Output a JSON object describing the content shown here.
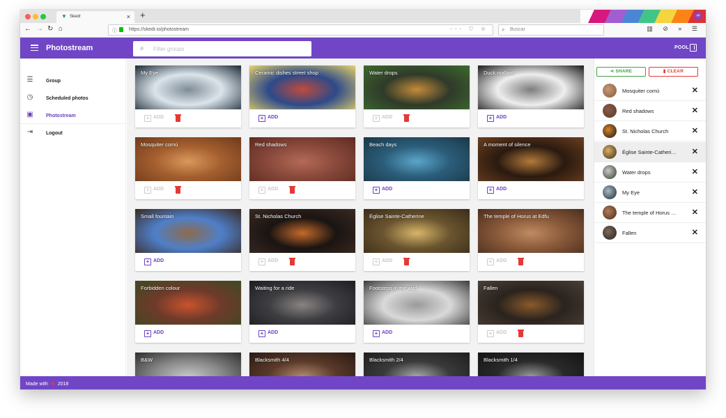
{
  "browser": {
    "tab_title": "Skedr",
    "tab_close": "×",
    "new_tab": "+",
    "url": "https://skedr.io/photostream",
    "url_actions": "··· ♡ ☆",
    "search_placeholder": "Buscar",
    "tools": "▥ ⊘ » ☰",
    "nav_back": "←",
    "nav_forward": "→",
    "nav_reload": "↻",
    "nav_home": "⌂"
  },
  "app": {
    "title": "Photostream",
    "filter_placeholder": "Filter groups",
    "pool_label": "POOL",
    "footer_prefix": "Made with",
    "footer_year": "2018"
  },
  "sidebar": {
    "items": [
      {
        "label": "Group",
        "icon": "☰"
      },
      {
        "label": "Scheduled photos",
        "icon": "◷"
      },
      {
        "label": "Photostream",
        "icon": "▣"
      },
      {
        "label": "Logout",
        "icon": "⇥"
      }
    ]
  },
  "photos": [
    {
      "title": "My Eye",
      "add": "ADD",
      "in_pool": true,
      "colors": [
        "#dbe4ea",
        "#7f8c97",
        "#1c2a38"
      ]
    },
    {
      "title": "Ceramic dishes street shop",
      "add": "ADD",
      "in_pool": false,
      "colors": [
        "#2d4a8a",
        "#c14a3b",
        "#e7d36a"
      ]
    },
    {
      "title": "Water drops",
      "add": "ADD",
      "in_pool": true,
      "colors": [
        "#2f3a2a",
        "#c58b3a",
        "#3d6b2e"
      ]
    },
    {
      "title": "Duck mallard",
      "add": "ADD",
      "in_pool": false,
      "colors": [
        "#eeeeee",
        "#7d7d7d",
        "#1a1a1a"
      ]
    },
    {
      "title": "Mosquiter comú",
      "add": "ADD",
      "in_pool": true,
      "colors": [
        "#a55f2f",
        "#d9985c",
        "#6d3b1c"
      ]
    },
    {
      "title": "Red shadows",
      "add": "ADD",
      "in_pool": true,
      "colors": [
        "#8a4a3c",
        "#b46a55",
        "#5e2b22"
      ]
    },
    {
      "title": "Beach days",
      "add": "ADD",
      "in_pool": false,
      "colors": [
        "#2b5d7a",
        "#5ba6c9",
        "#1b3846"
      ]
    },
    {
      "title": "A moment of silence",
      "add": "ADD",
      "in_pool": false,
      "colors": [
        "#2a1a10",
        "#b47a3a",
        "#6b3f1f"
      ]
    },
    {
      "title": "Small fountain",
      "add": "ADD",
      "in_pool": false,
      "colors": [
        "#4f7fc9",
        "#8d6b4a",
        "#3a2a22"
      ]
    },
    {
      "title": "St. Nicholas Church",
      "add": "ADD",
      "in_pool": true,
      "colors": [
        "#1a1412",
        "#c56a2a",
        "#3b2a22"
      ]
    },
    {
      "title": "Église Sainte-Catherine",
      "add": "ADD",
      "in_pool": true,
      "colors": [
        "#6b5530",
        "#d7b56a",
        "#3a2c18"
      ]
    },
    {
      "title": "The temple of Horus at Edfu",
      "add": "ADD",
      "in_pool": true,
      "colors": [
        "#8a5a3a",
        "#c08a62",
        "#4a2e1e"
      ]
    },
    {
      "title": "Forbidden colour",
      "add": "ADD",
      "in_pool": false,
      "colors": [
        "#6e3a2a",
        "#c9532e",
        "#3d4a22"
      ]
    },
    {
      "title": "Waiting for a ride",
      "add": "ADD",
      "in_pool": false,
      "colors": [
        "#3d3d42",
        "#8a8480",
        "#1e1e22"
      ]
    },
    {
      "title": "Footsteps in the wild",
      "add": "ADD",
      "in_pool": false,
      "colors": [
        "#d9d9d9",
        "#9a9a9a",
        "#3a3a3a"
      ]
    },
    {
      "title": "Fallen",
      "add": "ADD",
      "in_pool": true,
      "colors": [
        "#2a231e",
        "#8a5a2a",
        "#4a3f36"
      ]
    },
    {
      "title": "B&W",
      "add": "ADD",
      "in_pool": false,
      "colors": [
        "#8a8a8a",
        "#c8c8c8",
        "#2e2e2e"
      ]
    },
    {
      "title": "Blacksmith 4/4",
      "add": "ADD",
      "in_pool": false,
      "colors": [
        "#5a3a2a",
        "#b08a70",
        "#2a1a14"
      ]
    },
    {
      "title": "Blacksmith 2/4",
      "add": "ADD",
      "in_pool": false,
      "colors": [
        "#3a3a3a",
        "#a8a8a8",
        "#1e1e1e"
      ]
    },
    {
      "title": "Blacksmith 1/4",
      "add": "ADD",
      "in_pool": false,
      "colors": [
        "#2a2a2a",
        "#9a9a9a",
        "#141414"
      ]
    }
  ],
  "pool": {
    "share_label": "SHARE",
    "clear_label": "CLEAR",
    "items": [
      {
        "name": "Mosquiter comú",
        "colors": [
          "#c49a78",
          "#8a5a3a"
        ]
      },
      {
        "name": "Red shadows",
        "colors": [
          "#8a5a4a",
          "#5a3a2e"
        ]
      },
      {
        "name": "St. Nicholas Church",
        "colors": [
          "#d4842e",
          "#1a1412"
        ]
      },
      {
        "name": "Église Sainte-Catherine",
        "colors": [
          "#d9b066",
          "#3a2c18"
        ],
        "highlighted": true
      },
      {
        "name": "Water drops",
        "colors": [
          "#c9c9c9",
          "#2f3a2a"
        ]
      },
      {
        "name": "My Eye",
        "colors": [
          "#a9b7c2",
          "#1c2a38"
        ]
      },
      {
        "name": "The temple of Horus at Edfu",
        "colors": [
          "#b07a58",
          "#4a2e1e"
        ]
      },
      {
        "name": "Fallen",
        "colors": [
          "#7a6a5a",
          "#2a231e"
        ]
      }
    ]
  },
  "colors": {
    "brand": "#7046c6",
    "accent_purple": "#6a3fc1",
    "share_green": "#43a047",
    "delete_red": "#e53935"
  }
}
